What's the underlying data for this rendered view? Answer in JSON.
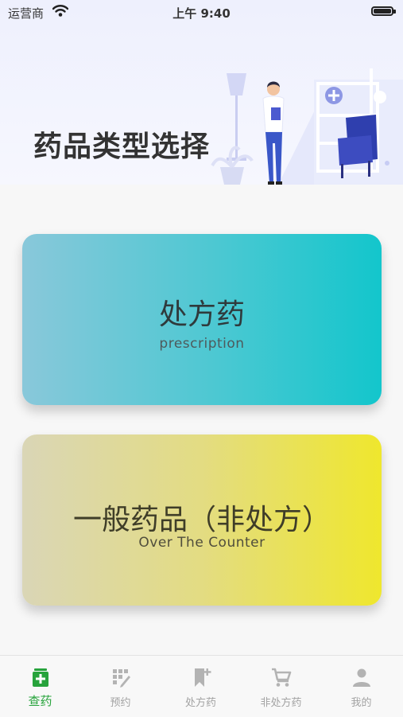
{
  "status_bar": {
    "carrier": "运营商",
    "time": "上午 9:40",
    "battery_level": 1.0
  },
  "header": {
    "title": "药品类型选择"
  },
  "cards": [
    {
      "title": "处方药",
      "subtitle": "prescription"
    },
    {
      "title": "一般药品（非处方）",
      "subtitle": "Over The Counter"
    }
  ],
  "tabs": [
    {
      "label": "查药",
      "icon": "medicine-kit-icon",
      "active": true
    },
    {
      "label": "预约",
      "icon": "appointment-grid-icon",
      "active": false
    },
    {
      "label": "处方药",
      "icon": "bookmark-plus-icon",
      "active": false
    },
    {
      "label": "非处方药",
      "icon": "cart-icon",
      "active": false
    },
    {
      "label": "我的",
      "icon": "person-icon",
      "active": false
    }
  ],
  "colors": {
    "accent": "#27a33c",
    "tab_inactive": "#a3a3a3",
    "card_rx_start": "#89c8da",
    "card_rx_end": "#13c6cc",
    "card_otc_start": "#dad6b6",
    "card_otc_end": "#efe72d"
  }
}
